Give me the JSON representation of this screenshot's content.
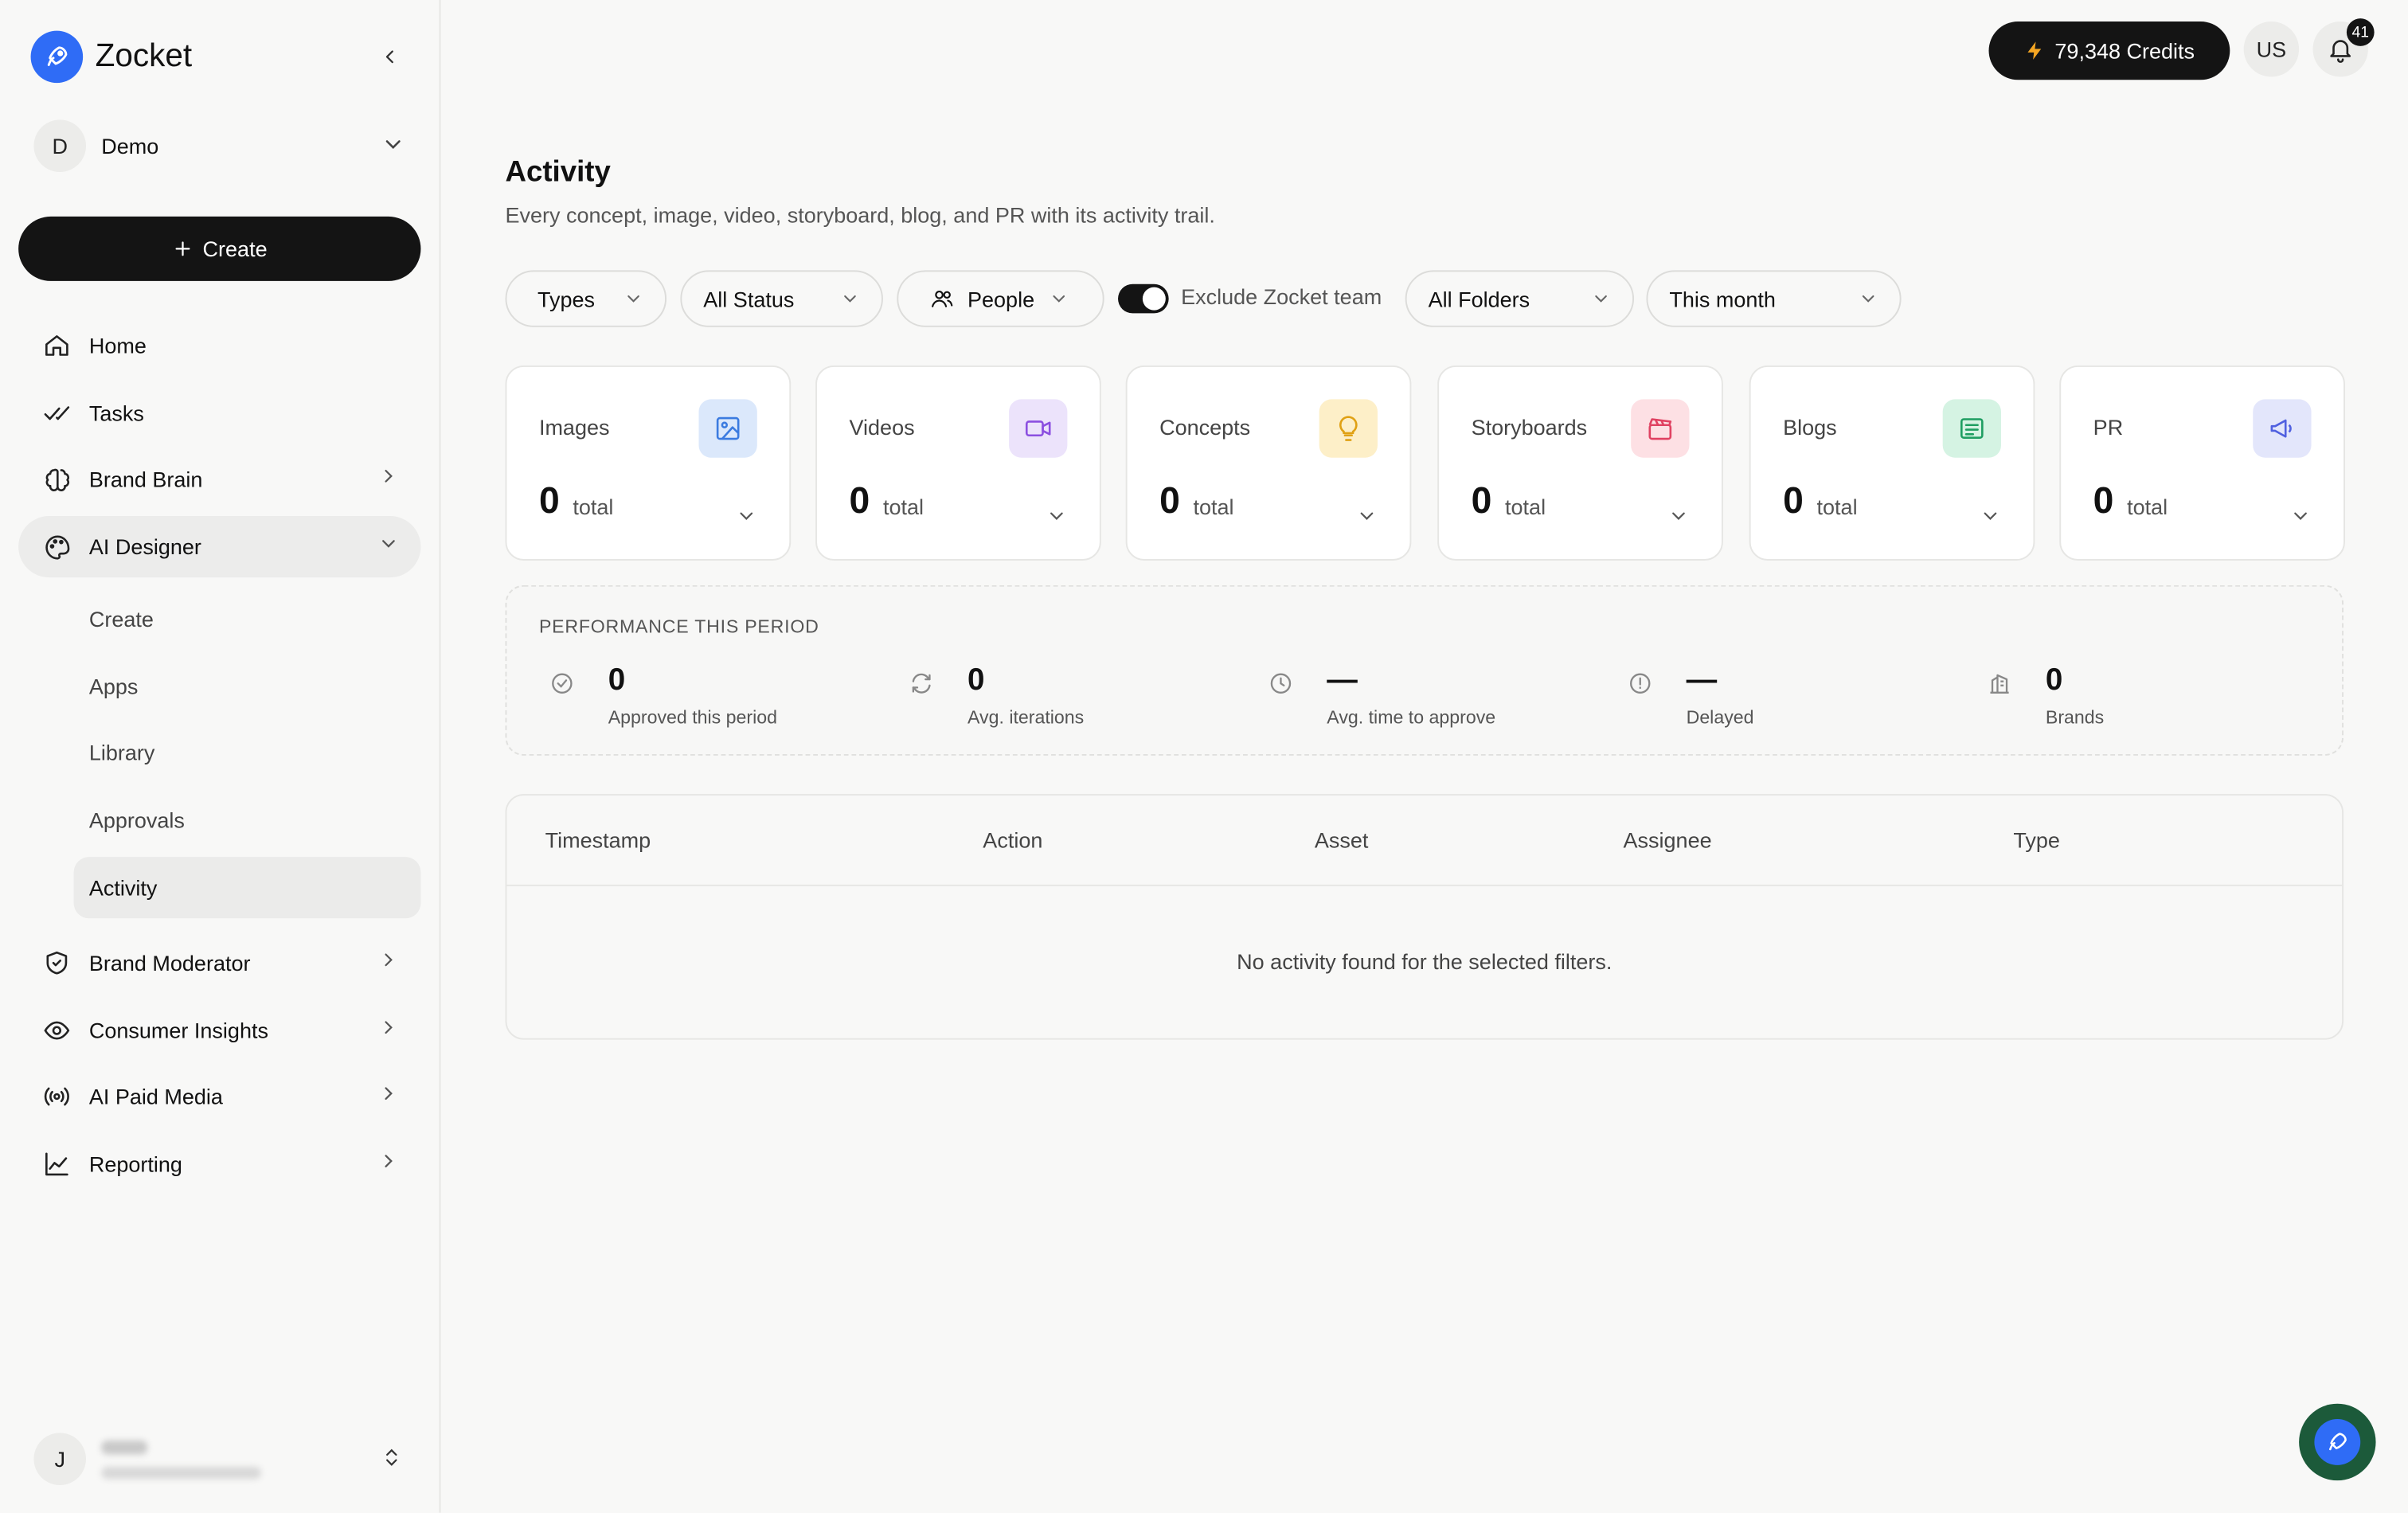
{
  "brand": {
    "name": "Zocket"
  },
  "workspace": {
    "initial": "D",
    "name": "Demo"
  },
  "sidebar": {
    "create_label": "Create",
    "items": [
      {
        "label": "Home",
        "icon": "home-icon"
      },
      {
        "label": "Tasks",
        "icon": "check-icon"
      },
      {
        "label": "Brand Brain",
        "icon": "brain-icon"
      },
      {
        "label": "AI Designer",
        "icon": "palette-icon"
      },
      {
        "label": "Brand Moderator",
        "icon": "shield-icon"
      },
      {
        "label": "Consumer Insights",
        "icon": "eye-icon"
      },
      {
        "label": "AI Paid Media",
        "icon": "broadcast-icon"
      },
      {
        "label": "Reporting",
        "icon": "chart-line-icon"
      }
    ],
    "sub_items": [
      "Create",
      "Apps",
      "Library",
      "Approvals",
      "Activity"
    ],
    "active_sub": "Activity"
  },
  "user": {
    "initial": "J"
  },
  "topbar": {
    "credits": "79,348 Credits",
    "avatar": "US",
    "notifications": "41"
  },
  "page": {
    "title": "Activity",
    "subtitle": "Every concept, image, video, storyboard, blog, and PR with its activity trail."
  },
  "filters": {
    "types": "Types",
    "status": "All Status",
    "people": "People",
    "exclude_label": "Exclude Zocket team",
    "exclude_on": true,
    "folders": "All Folders",
    "period": "This month"
  },
  "stats": [
    {
      "label": "Images",
      "value": "0",
      "unit": "total",
      "icon": "image-icon",
      "bg": "#dbe8fb",
      "fg": "#3b7be0"
    },
    {
      "label": "Videos",
      "value": "0",
      "unit": "total",
      "icon": "video-icon",
      "bg": "#ece3fb",
      "fg": "#8b4fe0"
    },
    {
      "label": "Concepts",
      "value": "0",
      "unit": "total",
      "icon": "lightbulb-icon",
      "bg": "#fdefc8",
      "fg": "#e0a114"
    },
    {
      "label": "Storyboards",
      "value": "0",
      "unit": "total",
      "icon": "clapperboard-icon",
      "bg": "#fde0e4",
      "fg": "#e04262"
    },
    {
      "label": "Blogs",
      "value": "0",
      "unit": "total",
      "icon": "document-icon",
      "bg": "#d5f3e3",
      "fg": "#1f9e62"
    },
    {
      "label": "PR",
      "value": "0",
      "unit": "total",
      "icon": "megaphone-icon",
      "bg": "#e3e6fb",
      "fg": "#5060e0"
    }
  ],
  "performance": {
    "title": "PERFORMANCE THIS PERIOD",
    "metrics": [
      {
        "value": "0",
        "label": "Approved this period",
        "icon": "check-circle-icon"
      },
      {
        "value": "0",
        "label": "Avg. iterations",
        "icon": "refresh-icon"
      },
      {
        "value": "—",
        "label": "Avg. time to approve",
        "icon": "clock-icon"
      },
      {
        "value": "—",
        "label": "Delayed",
        "icon": "alert-circle-icon"
      },
      {
        "value": "0",
        "label": "Brands",
        "icon": "building-icon"
      }
    ]
  },
  "table": {
    "columns": [
      "Timestamp",
      "Action",
      "Asset",
      "Assignee",
      "Type"
    ],
    "empty_message": "No activity found for the selected filters."
  }
}
